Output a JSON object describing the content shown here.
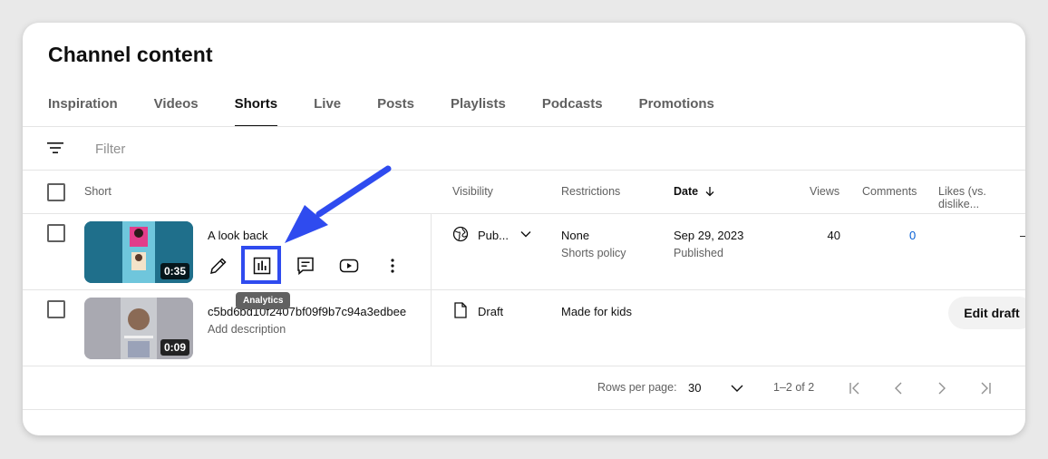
{
  "page": {
    "title": "Channel content"
  },
  "tabs": [
    {
      "label": "Inspiration"
    },
    {
      "label": "Videos"
    },
    {
      "label": "Shorts"
    },
    {
      "label": "Live"
    },
    {
      "label": "Posts"
    },
    {
      "label": "Playlists"
    },
    {
      "label": "Podcasts"
    },
    {
      "label": "Promotions"
    }
  ],
  "active_tab": "Shorts",
  "filter": {
    "placeholder": "Filter",
    "icon": "filter-icon"
  },
  "columns": {
    "short": "Short",
    "visibility": "Visibility",
    "restrictions": "Restrictions",
    "date": "Date",
    "views": "Views",
    "comments": "Comments",
    "likes": "Likes (vs. dislike..."
  },
  "rows": [
    {
      "title": "A look back",
      "duration": "0:35",
      "visibility": "Pub...",
      "visibility_icon": "globe-icon",
      "restriction": "None",
      "restriction_sub": "Shorts policy",
      "date": "Sep 29, 2023",
      "date_sub": "Published",
      "views": "40",
      "comments": "0",
      "likes": "–"
    },
    {
      "title": "c5bd6bd10f2407bf09f9b7c94a3edbee",
      "description": "Add description",
      "duration": "0:09",
      "visibility": "Draft",
      "visibility_icon": "draft-file-icon",
      "restriction": "Made for kids",
      "action": "Edit draft"
    }
  ],
  "tooltip": "Analytics",
  "pagination": {
    "rows_per_page_label": "Rows per page:",
    "rows_per_page": "30",
    "range": "1–2 of 2"
  },
  "colors": {
    "accent_blue": "#2f4bef",
    "link_blue": "#065fd4",
    "thumb1": "#1f6f8b",
    "thumb2": "#b9b9bf"
  }
}
